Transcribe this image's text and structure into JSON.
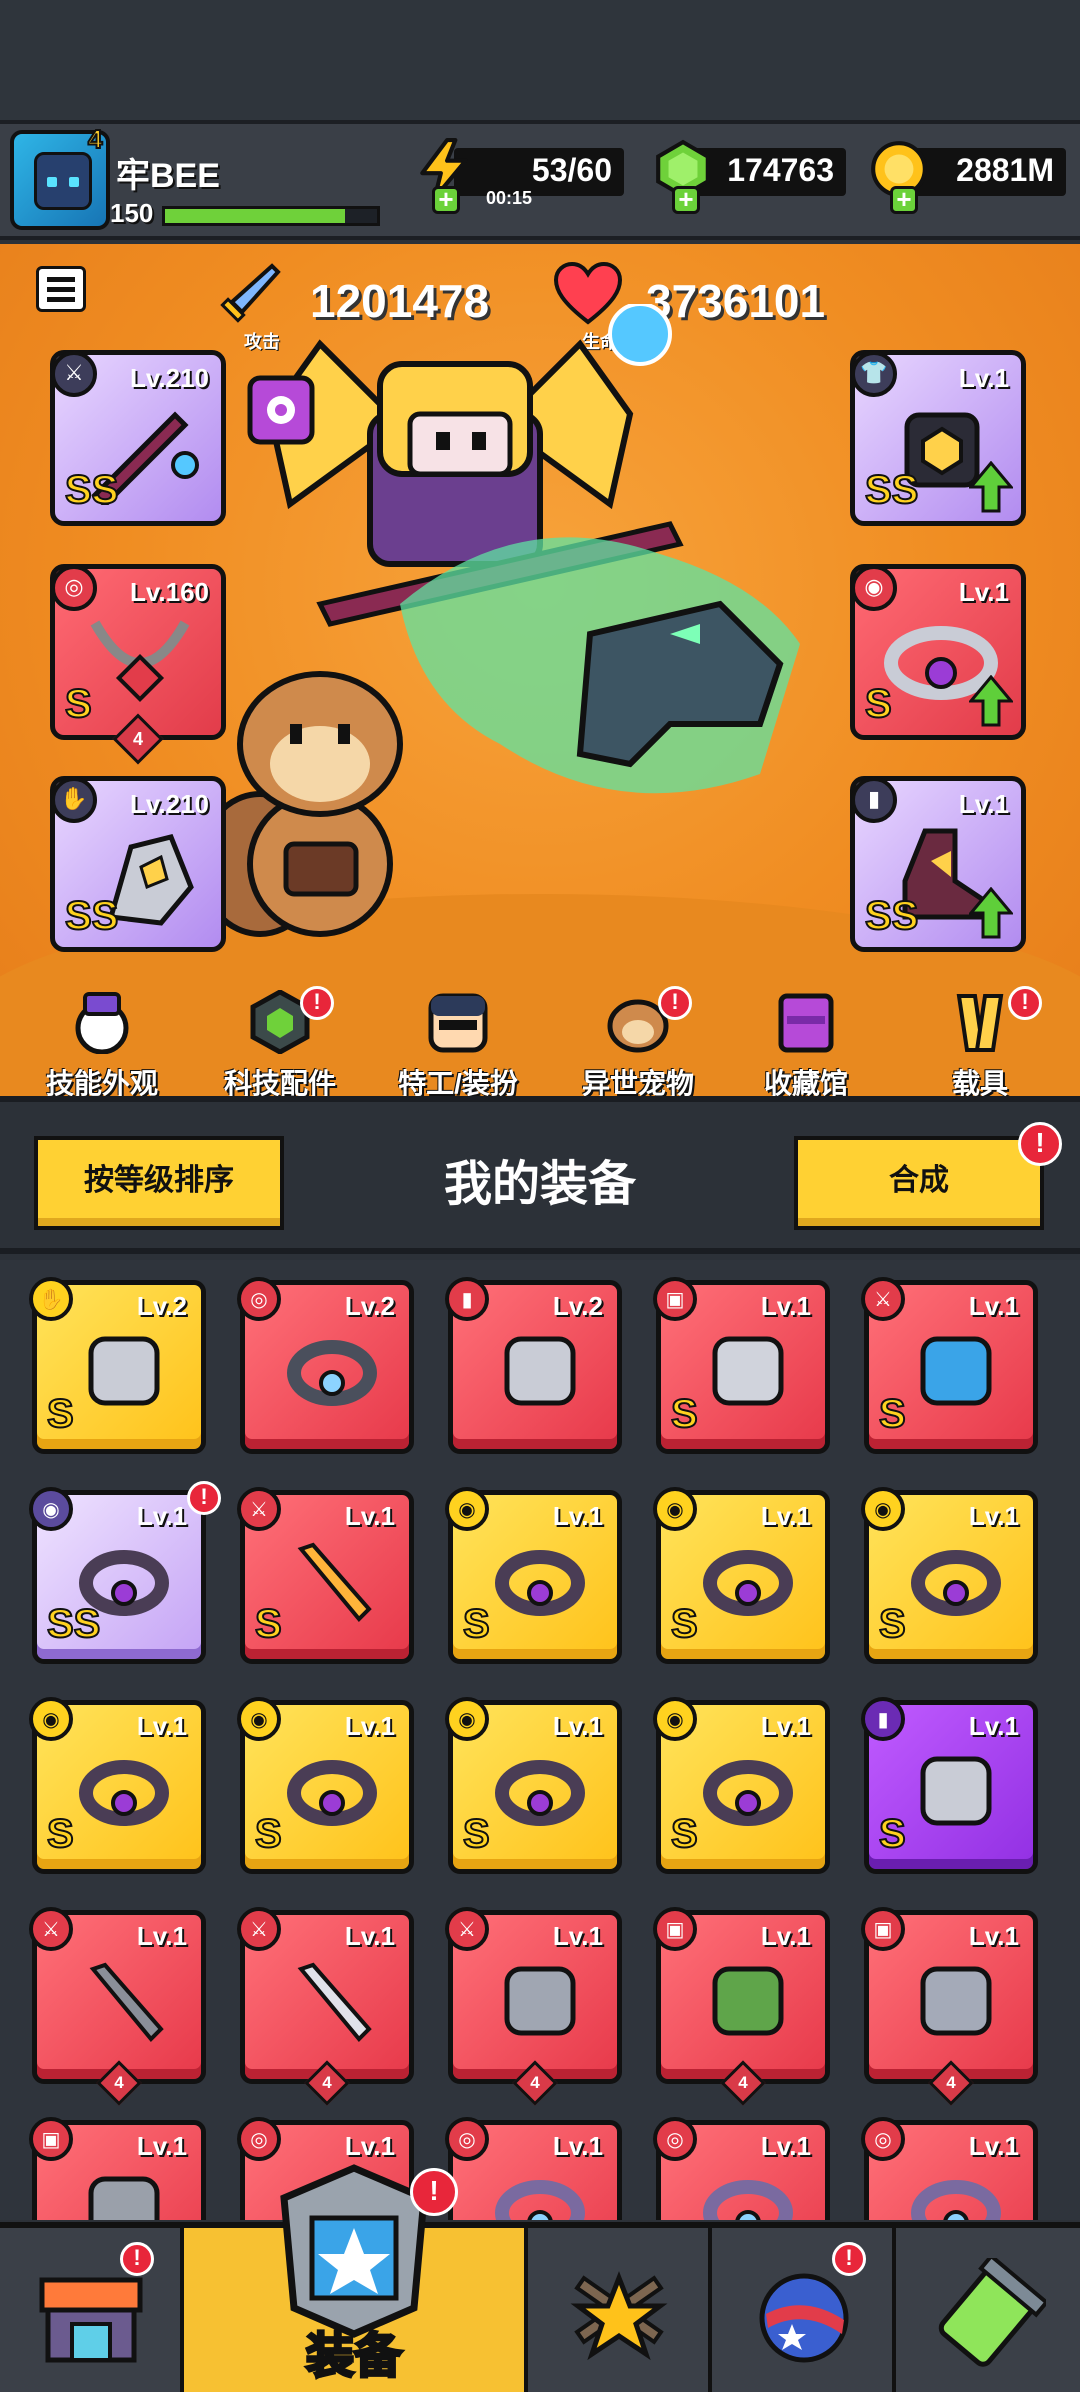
{
  "player": {
    "name": "牢BEE",
    "level": "150",
    "star": "4",
    "xp_fraction": 0.85
  },
  "resources": {
    "energy": {
      "value": "53/60",
      "timer": "00:15",
      "icon": "lightning-icon"
    },
    "gems": {
      "value": "174763",
      "icon": "green-gem-icon"
    },
    "gold": {
      "value": "2881M",
      "icon": "gold-coin-icon"
    }
  },
  "stats": {
    "attack": {
      "label": "攻击",
      "value": "1201478"
    },
    "hp": {
      "label": "生命",
      "value": "3736101"
    }
  },
  "equipped": {
    "left": [
      {
        "slot": "weapon",
        "level": "Lv.210",
        "rank": "SS",
        "rarity": "purple"
      },
      {
        "slot": "necklace",
        "level": "Lv.160",
        "rank": "S",
        "rarity": "red",
        "qty": "4"
      },
      {
        "slot": "gloves",
        "level": "Lv.210",
        "rank": "SS",
        "rarity": "purple"
      }
    ],
    "right": [
      {
        "slot": "armor",
        "level": "Lv.1",
        "rank": "SS",
        "rarity": "purple"
      },
      {
        "slot": "belt",
        "level": "Lv.1",
        "rank": "S",
        "rarity": "red"
      },
      {
        "slot": "boots",
        "level": "Lv.1",
        "rank": "SS",
        "rarity": "purple"
      }
    ]
  },
  "features": [
    {
      "label": "技能外观",
      "icon": "skill-skin-icon",
      "badge": false
    },
    {
      "label": "科技配件",
      "icon": "tech-parts-icon",
      "badge": true
    },
    {
      "label": "特工/装扮",
      "icon": "agent-costume-icon",
      "badge": false
    },
    {
      "label": "异世宠物",
      "icon": "pet-icon",
      "badge": true
    },
    {
      "label": "收藏馆",
      "icon": "collection-icon",
      "badge": false
    },
    {
      "label": "载具",
      "icon": "vehicle-icon",
      "badge": true
    }
  ],
  "equipment_panel": {
    "sort_label": "按等级排序",
    "title": "我的装备",
    "merge_label": "合成"
  },
  "inventory": [
    {
      "level": "Lv.2",
      "rank": "S",
      "color": "y",
      "slot": "gloves",
      "item": "gauntlet"
    },
    {
      "level": "Lv.2",
      "rank": "",
      "color": "r",
      "slot": "necklace",
      "item": "spiked-collar"
    },
    {
      "level": "Lv.2",
      "rank": "",
      "color": "r",
      "slot": "boots",
      "item": "boot"
    },
    {
      "level": "Lv.1",
      "rank": "S",
      "color": "r",
      "slot": "armor",
      "item": "chest-armor"
    },
    {
      "level": "Lv.1",
      "rank": "S",
      "color": "r",
      "slot": "weapon",
      "item": "water-gun"
    },
    {
      "level": "Lv.1",
      "rank": "SS",
      "color": "w",
      "slot": "belt",
      "item": "belt"
    },
    {
      "level": "Lv.1",
      "rank": "S",
      "color": "r",
      "slot": "weapon",
      "item": "sword"
    },
    {
      "level": "Lv.1",
      "rank": "S",
      "color": "y",
      "slot": "belt",
      "item": "belt"
    },
    {
      "level": "Lv.1",
      "rank": "S",
      "color": "y",
      "slot": "belt",
      "item": "belt"
    },
    {
      "level": "Lv.1",
      "rank": "S",
      "color": "y",
      "slot": "belt",
      "item": "belt"
    },
    {
      "level": "Lv.1",
      "rank": "S",
      "color": "y",
      "slot": "belt",
      "item": "belt"
    },
    {
      "level": "Lv.1",
      "rank": "S",
      "color": "y",
      "slot": "belt",
      "item": "belt"
    },
    {
      "level": "Lv.1",
      "rank": "S",
      "color": "y",
      "slot": "belt",
      "item": "belt"
    },
    {
      "level": "Lv.1",
      "rank": "S",
      "color": "y",
      "slot": "belt",
      "item": "belt"
    },
    {
      "level": "Lv.1",
      "rank": "S",
      "color": "p",
      "slot": "boots",
      "item": "boot"
    },
    {
      "level": "Lv.1",
      "rank": "",
      "color": "r",
      "slot": "weapon",
      "item": "kunai",
      "qty": "4"
    },
    {
      "level": "Lv.1",
      "rank": "",
      "color": "r",
      "slot": "weapon",
      "item": "machete",
      "qty": "4"
    },
    {
      "level": "Lv.1",
      "rank": "",
      "color": "r",
      "slot": "weapon",
      "item": "revolver",
      "qty": "4"
    },
    {
      "level": "Lv.1",
      "rank": "",
      "color": "r",
      "slot": "armor",
      "item": "green-vest",
      "qty": "4"
    },
    {
      "level": "Lv.1",
      "rank": "",
      "color": "r",
      "slot": "armor",
      "item": "steel-armor",
      "qty": "4"
    },
    {
      "level": "Lv.1",
      "rank": "",
      "color": "r",
      "slot": "armor",
      "item": "armor"
    },
    {
      "level": "Lv.1",
      "rank": "",
      "color": "r",
      "slot": "necklace",
      "item": "necklace"
    },
    {
      "level": "Lv.1",
      "rank": "",
      "color": "r",
      "slot": "necklace",
      "item": "necklace"
    },
    {
      "level": "Lv.1",
      "rank": "",
      "color": "r",
      "slot": "necklace",
      "item": "necklace"
    },
    {
      "level": "Lv.1",
      "rank": "",
      "color": "r",
      "slot": "necklace",
      "item": "necklace"
    }
  ],
  "nav": [
    {
      "label": "",
      "icon": "shop-icon",
      "badge": true
    },
    {
      "label": "装备",
      "icon": "equipment-icon",
      "badge": true,
      "active": true
    },
    {
      "label": "",
      "icon": "battle-star-icon",
      "badge": false
    },
    {
      "label": "",
      "icon": "planet-icon",
      "badge": true
    },
    {
      "label": "",
      "icon": "gene-capsule-icon",
      "badge": false
    }
  ],
  "colors": {
    "stage_orange": "#f08d22",
    "panel_dark": "#2f343c",
    "accent_yellow": "#ffd133",
    "badge_red": "#e8263a"
  }
}
